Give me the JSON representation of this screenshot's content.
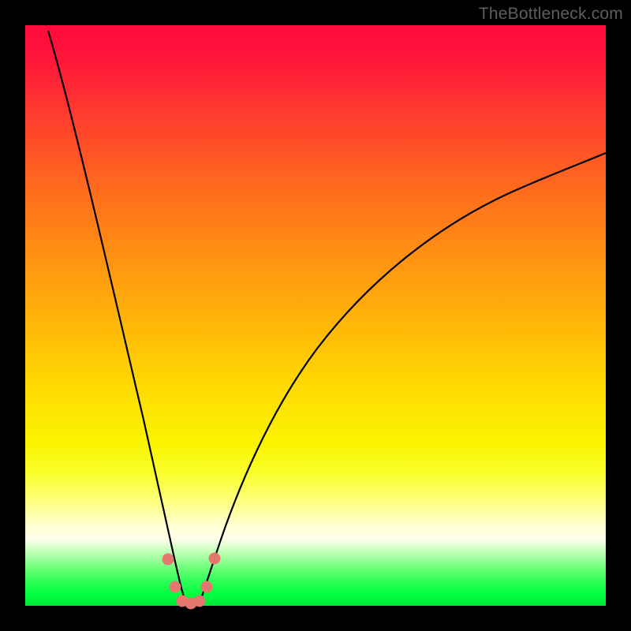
{
  "watermark": "TheBottleneck.com",
  "colors": {
    "frame": "#000000",
    "gradient_top": "#ff0a3c",
    "gradient_bottom": "#00e838",
    "curve": "#000000",
    "marker": "#e4786f"
  },
  "chart_data": {
    "type": "line",
    "title": "",
    "xlabel": "",
    "ylabel": "",
    "xlim": [
      0,
      100
    ],
    "ylim": [
      0,
      100
    ],
    "note": "Axes are unlabeled; x is normalized horizontal position (0=left edge of plot, 100=right edge), y is normalized bottleneck percentage (0=bottom/green, 100=top/red). Values estimated from pixel positions.",
    "curve_left": {
      "name": "left-branch",
      "x": [
        4.0,
        6.0,
        8.0,
        10.0,
        12.0,
        14.0,
        16.0,
        18.0,
        20.0,
        22.0,
        23.5,
        25.0,
        26.0,
        27.0
      ],
      "y": [
        99.0,
        91.0,
        82.0,
        73.0,
        63.0,
        53.0,
        44.0,
        35.0,
        26.0,
        17.5,
        11.0,
        5.5,
        2.5,
        0.2
      ]
    },
    "curve_right": {
      "name": "right-branch",
      "x": [
        30.0,
        31.5,
        33.0,
        35.0,
        38.0,
        42.0,
        47.0,
        53.0,
        60.0,
        68.0,
        77.0,
        87.0,
        100.0
      ],
      "y": [
        0.2,
        3.0,
        8.0,
        15.0,
        24.0,
        33.5,
        42.5,
        50.5,
        57.5,
        63.5,
        68.5,
        73.0,
        78.0
      ]
    },
    "markers": [
      {
        "x": 24.2,
        "y": 8.0
      },
      {
        "x": 25.6,
        "y": 3.0
      },
      {
        "x": 27.0,
        "y": 0.5
      },
      {
        "x": 28.5,
        "y": 0.2
      },
      {
        "x": 30.0,
        "y": 0.6
      },
      {
        "x": 31.2,
        "y": 3.2
      },
      {
        "x": 32.6,
        "y": 8.2
      }
    ]
  }
}
